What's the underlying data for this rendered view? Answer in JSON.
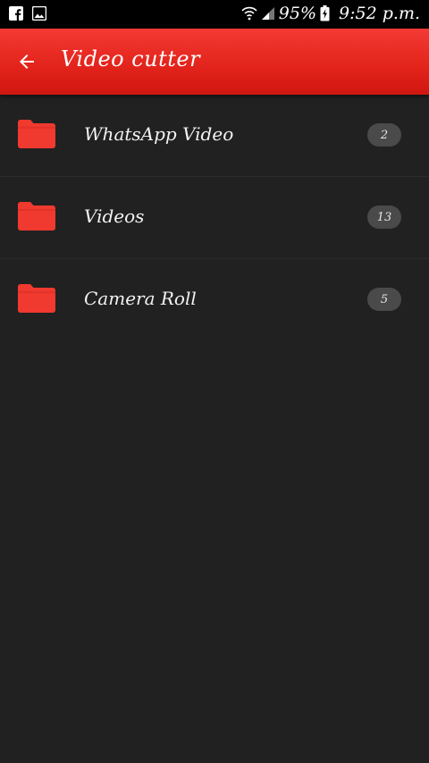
{
  "status_bar": {
    "icons": [
      "facebook-icon",
      "image-icon",
      "wifi-icon",
      "signal-icon",
      "battery-charging-icon"
    ],
    "battery": "95%",
    "time": "9:52 p.m."
  },
  "app_bar": {
    "title": "Video cutter",
    "back_icon": "arrow-back-icon",
    "color": "#e3231c"
  },
  "folders": [
    {
      "label": "WhatsApp Video",
      "count": "2"
    },
    {
      "label": "Videos",
      "count": "13"
    },
    {
      "label": "Camera Roll",
      "count": "5"
    }
  ],
  "colors": {
    "background": "#212121",
    "folder_icon": "#f0392f",
    "badge": "#4a4a4a"
  }
}
